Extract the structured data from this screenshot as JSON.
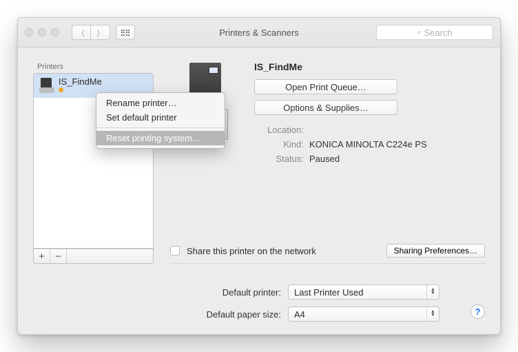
{
  "titlebar": {
    "title": "Printers & Scanners",
    "search_placeholder": "Search"
  },
  "sidebar": {
    "header": "Printers",
    "items": [
      {
        "name": "IS_FindMe",
        "status": ""
      }
    ],
    "add": "+",
    "remove": "−"
  },
  "context_menu": {
    "rename": "Rename printer…",
    "set_default": "Set default printer",
    "reset": "Reset printing system…"
  },
  "detail": {
    "name": "IS_FindMe",
    "open_queue": "Open Print Queue…",
    "options": "Options & Supplies…",
    "location_label": "Location:",
    "location_value": "",
    "kind_label": "Kind:",
    "kind_value": "KONICA MINOLTA C224e PS",
    "status_label": "Status:",
    "status_value": "Paused",
    "share_label": "Share this printer on the network",
    "sharing_prefs": "Sharing Preferences…"
  },
  "bottom": {
    "default_printer_label": "Default printer:",
    "default_printer_value": "Last Printer Used",
    "paper_size_label": "Default paper size:",
    "paper_size_value": "A4"
  },
  "help": "?"
}
